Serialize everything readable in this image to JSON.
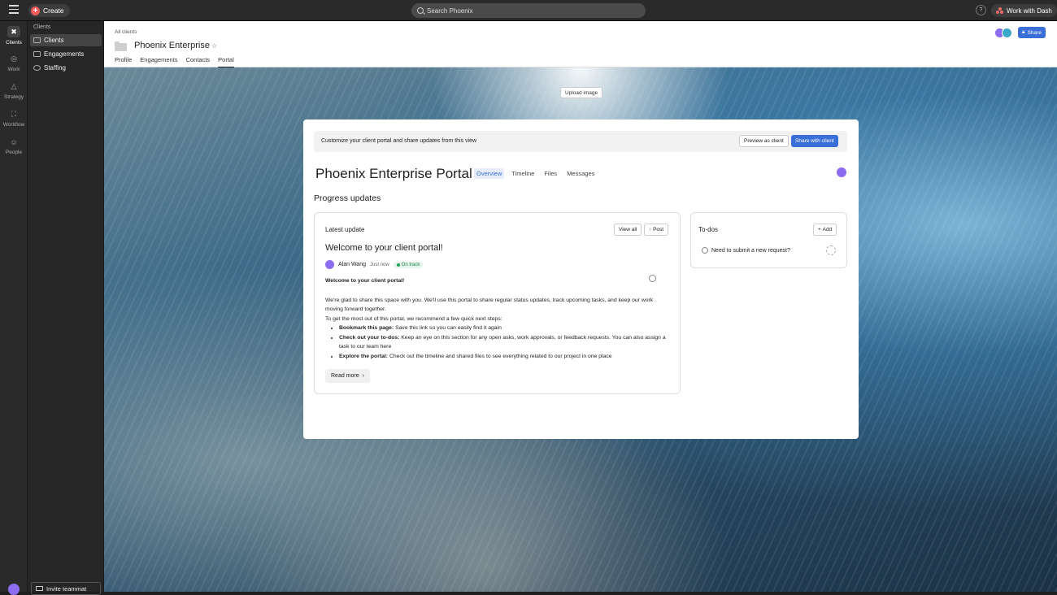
{
  "topbar": {
    "create": "Create",
    "search_placeholder": "Search Phoenix",
    "help": "?",
    "dash": "Work with Dash"
  },
  "rail": [
    {
      "label": "Clients",
      "icon": "clients-icon",
      "active": true
    },
    {
      "label": "Work",
      "icon": "check-icon",
      "active": false
    },
    {
      "label": "Strategy",
      "icon": "triangle-icon",
      "active": false
    },
    {
      "label": "Workflow",
      "icon": "workflow-icon",
      "active": false
    },
    {
      "label": "People",
      "icon": "people-icon",
      "active": false
    }
  ],
  "sidebar": {
    "heading": "Clients",
    "items": [
      {
        "label": "Clients",
        "active": true
      },
      {
        "label": "Engagements",
        "active": false
      },
      {
        "label": "Staffing",
        "active": false
      }
    ],
    "invite": "Invite teammat"
  },
  "header": {
    "breadcrumb": "All clients",
    "title": "Phoenix Enterprise",
    "tabs": [
      "Profile",
      "Engagements",
      "Contacts",
      "Portal"
    ],
    "active_tab": "Portal",
    "share": "Share"
  },
  "upload": "Upload image",
  "portal": {
    "banner_text": "Customize your client portal and share updates from this view",
    "preview": "Preview as client",
    "share_client": "Share with client",
    "title": "Phoenix Enterprise Portal",
    "tabs": [
      "Overview",
      "Timeline",
      "Files",
      "Messages"
    ],
    "section": "Progress updates",
    "latest": {
      "heading": "Latest update",
      "view_all": "View all",
      "post": "Post",
      "headline": "Welcome to your client portal!",
      "author": "Alan Wang",
      "time": "Just now",
      "status": "On track",
      "bold_intro": "Welcome to your client portal!",
      "para1": "We're glad to share this space with you. We'll use this portal to share regular status updates, track upcoming tasks, and keep our work moving forward together.",
      "para2": "To get the most out of this portal, we recommend a few quick next steps:",
      "bullets": [
        {
          "b": "Bookmark this page:",
          "t": " Save this link so you can easily find it again"
        },
        {
          "b": "Check out your to-dos:",
          "t": " Keep an eye on this section for any open asks, work approvals, or feedback requests. You can also assign a task to our team here"
        },
        {
          "b": "Explore the portal:",
          "t": " Check out the timeline and shared files to see everything related to our project in one place"
        }
      ],
      "read_more": "Read more"
    },
    "todos": {
      "heading": "To-dos",
      "add": "Add",
      "item": "Need to submit a new request?"
    }
  },
  "colors": {
    "accent": "#3a6fd8",
    "create": "#f05a5a",
    "status_green": "#27a05a"
  }
}
